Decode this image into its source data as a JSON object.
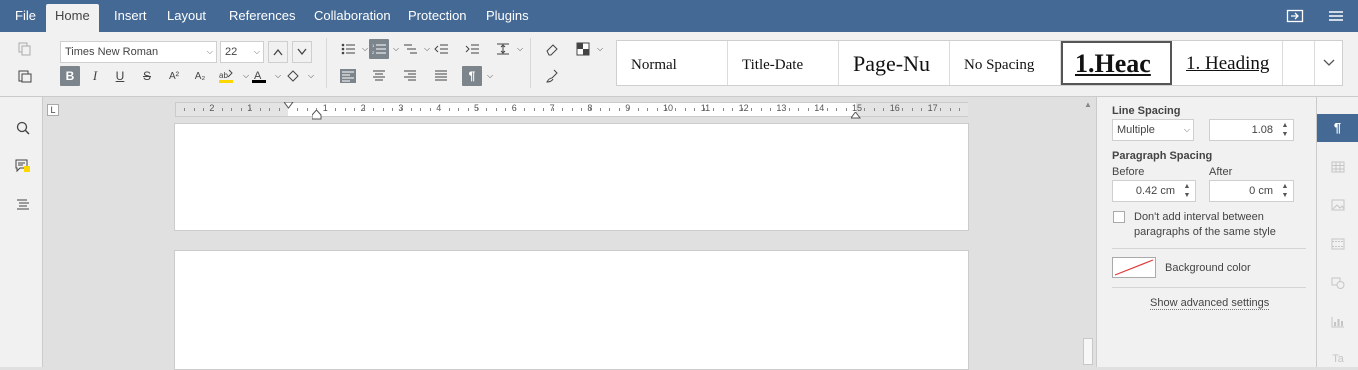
{
  "menu": {
    "tabs": [
      "File",
      "Home",
      "Insert",
      "Layout",
      "References",
      "Collaboration",
      "Protection",
      "Plugins"
    ],
    "active_tab": "Home"
  },
  "toolbar": {
    "font_name": "Times New Roman",
    "font_size": "22",
    "styles": [
      "Normal",
      "Title-Date",
      "Page-Nu",
      "No Spacing",
      "1.Heac",
      "1. Heading"
    ],
    "selected_style": "1.Heac"
  },
  "ruler": {
    "labels": [
      "2",
      "1",
      "1",
      "2",
      "3",
      "4",
      "5",
      "6",
      "7",
      "8",
      "9",
      "10",
      "11",
      "12",
      "13",
      "14",
      "15",
      "16",
      "17"
    ]
  },
  "panel": {
    "line_spacing_title": "Line Spacing",
    "line_spacing_mode": "Multiple",
    "line_spacing_value": "1.08",
    "paragraph_spacing_title": "Paragraph Spacing",
    "before_label": "Before",
    "before_value": "0.42 cm",
    "after_label": "After",
    "after_value": "0 cm",
    "no_interval_label": "Don't add interval between paragraphs of the same style",
    "no_interval_checked": false,
    "background_color_label": "Background color",
    "advanced_link": "Show advanced settings"
  },
  "colors": {
    "menubar": "#446995",
    "highlight": "#ffd700",
    "font_color": "#000000"
  }
}
